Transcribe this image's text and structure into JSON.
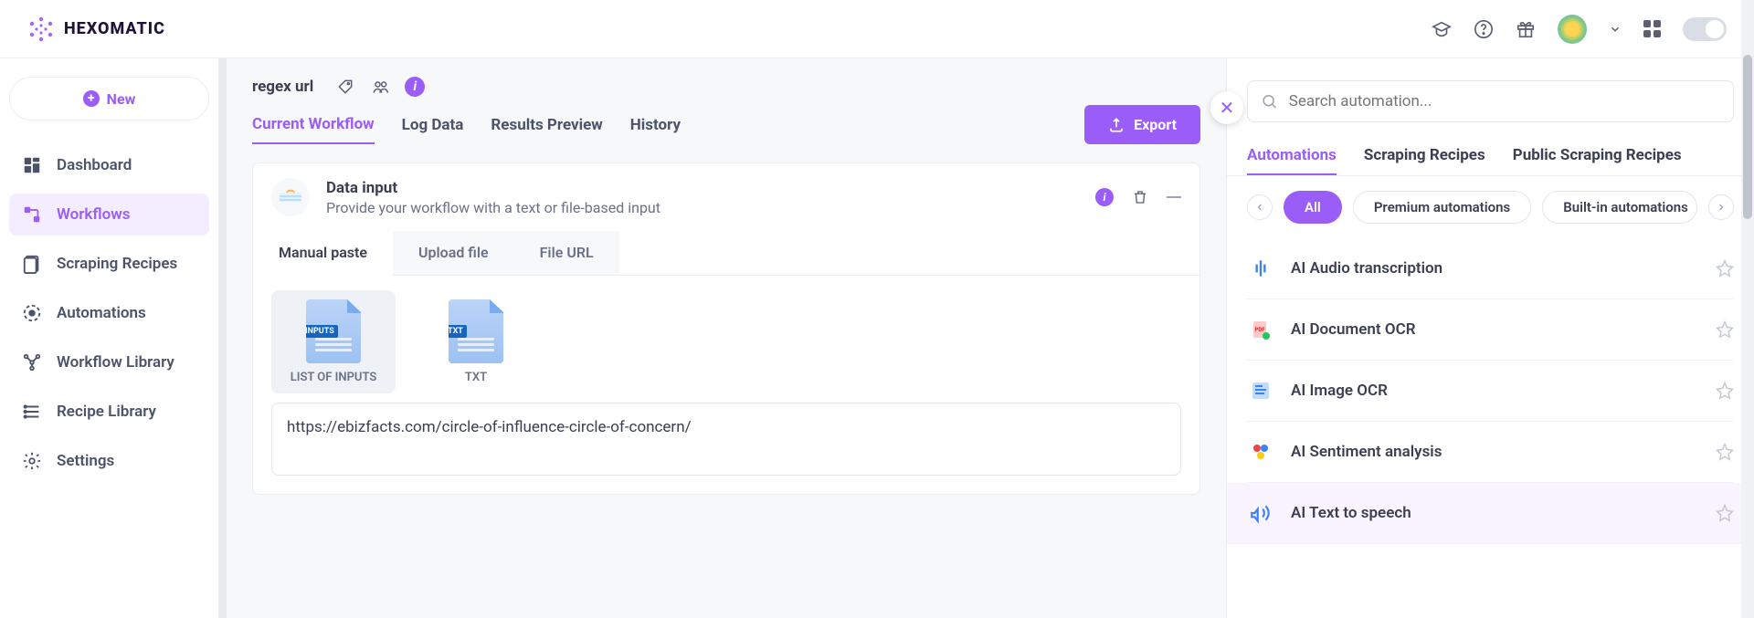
{
  "brand": {
    "name": "HEXOMATIC"
  },
  "topbar": {},
  "sidebar": {
    "new_label": "New",
    "items": [
      {
        "label": "Dashboard"
      },
      {
        "label": "Workflows"
      },
      {
        "label": "Scraping Recipes"
      },
      {
        "label": "Automations"
      },
      {
        "label": "Workflow Library"
      },
      {
        "label": "Recipe Library"
      },
      {
        "label": "Settings"
      }
    ]
  },
  "workflow": {
    "title": "regex url",
    "tabs": [
      {
        "label": "Current Workflow"
      },
      {
        "label": "Log Data"
      },
      {
        "label": "Results Preview"
      },
      {
        "label": "History"
      }
    ],
    "export_label": "Export",
    "data_input": {
      "title": "Data input",
      "subtitle": "Provide your workflow with a text or file-based input",
      "subtabs": [
        {
          "label": "Manual paste"
        },
        {
          "label": "Upload file"
        },
        {
          "label": "File URL"
        }
      ],
      "types": [
        {
          "badge": "INPUTS",
          "label": "LIST OF INPUTS"
        },
        {
          "badge": "TXT",
          "label": "TXT"
        }
      ],
      "url_value": "https://ebizfacts.com/circle-of-influence-circle-of-concern/"
    }
  },
  "right_panel": {
    "search_placeholder": "Search automation...",
    "tabs": [
      {
        "label": "Automations"
      },
      {
        "label": "Scraping Recipes"
      },
      {
        "label": "Public Scraping Recipes"
      }
    ],
    "chips": [
      {
        "label": "All"
      },
      {
        "label": "Premium automations"
      },
      {
        "label": "Built-in automations"
      }
    ],
    "items": [
      {
        "label": "AI Audio transcription",
        "icon": "audio"
      },
      {
        "label": "AI Document OCR",
        "icon": "doc"
      },
      {
        "label": "AI Image OCR",
        "icon": "image"
      },
      {
        "label": "AI Sentiment analysis",
        "icon": "sentiment"
      },
      {
        "label": "AI Text to speech",
        "icon": "tts"
      }
    ]
  }
}
